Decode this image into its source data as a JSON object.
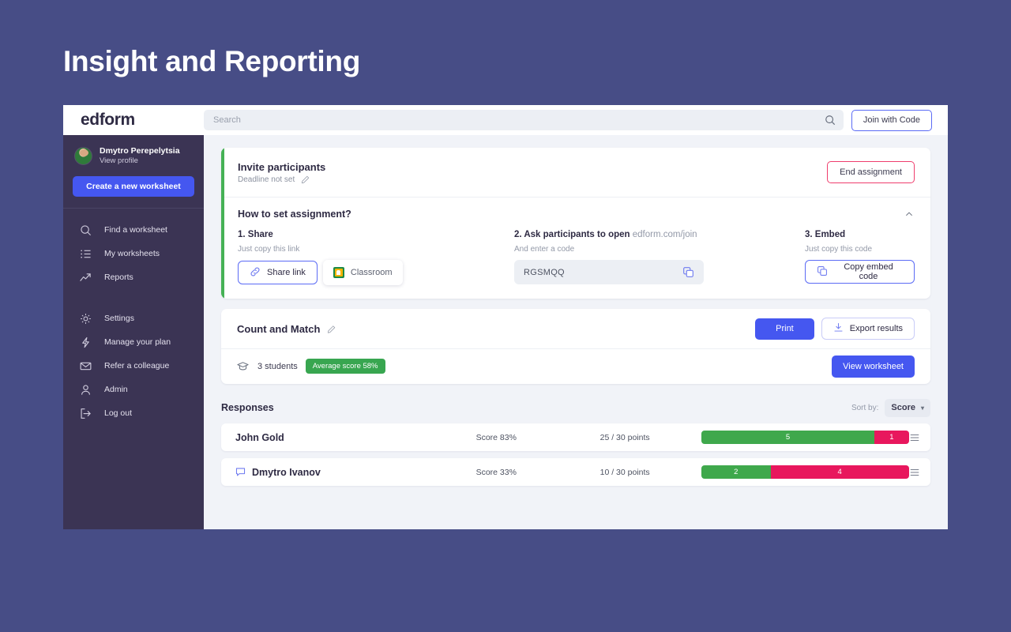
{
  "page": {
    "title": "Insight and Reporting"
  },
  "topbar": {
    "brand": "edform",
    "search_placeholder": "Search",
    "search_value": "",
    "join_label": "Join with Code"
  },
  "sidebar": {
    "profile": {
      "name": "Dmytro Perepelytsia",
      "link": "View profile"
    },
    "create_label": "Create a new worksheet",
    "items": [
      {
        "label": "Find a worksheet",
        "icon": "search-icon"
      },
      {
        "label": "My worksheets",
        "icon": "list-icon"
      },
      {
        "label": "Reports",
        "icon": "trend-up-icon"
      },
      {
        "label": "Settings",
        "icon": "gear-icon"
      },
      {
        "label": "Manage your plan",
        "icon": "bolt-icon"
      },
      {
        "label": "Refer a colleague",
        "icon": "envelope-icon"
      },
      {
        "label": "Admin",
        "icon": "user-icon"
      },
      {
        "label": "Log out",
        "icon": "logout-icon"
      }
    ]
  },
  "invite": {
    "title": "Invite participants",
    "deadline": "Deadline not set",
    "end_label": "End assignment",
    "howto_title": "How to set assignment?",
    "step1": {
      "title": "1. Share",
      "sub": "Just copy this link",
      "share_label": "Share link",
      "classroom_label": "Classroom"
    },
    "step2": {
      "title_bold": "2. Ask participants to open",
      "title_muted": "edform.com/join",
      "sub": "And enter a code",
      "code": "RGSMQQ"
    },
    "step3": {
      "title": "3. Embed",
      "sub": "Just copy this code",
      "copy_label": "Copy embed code"
    }
  },
  "worksheet": {
    "title": "Count and Match",
    "print_label": "Print",
    "export_label": "Export results",
    "students": "3 students",
    "avg_badge": "Average score 58%",
    "view_label": "View worksheet"
  },
  "responses": {
    "heading": "Responses",
    "sort_label": "Sort by:",
    "sort_value": "Score",
    "rows": [
      {
        "name": "John Gold",
        "has_comment": false,
        "score": "Score 83%",
        "points": "25 / 30 points",
        "correct": 5,
        "incorrect": 1,
        "correct_label": "5",
        "incorrect_label": "1"
      },
      {
        "name": "Dmytro Ivanov",
        "has_comment": true,
        "score": "Score 33%",
        "points": "10 / 30 points",
        "correct": 2,
        "incorrect": 4,
        "correct_label": "2",
        "incorrect_label": "4"
      }
    ]
  },
  "colors": {
    "backdrop": "#474d86",
    "sidebar": "#3b3454",
    "accent_blue": "#4557f0",
    "accent_green": "#45b155",
    "bar_green": "#3fa84c",
    "bar_red": "#e8175d",
    "badge_green": "#38a650",
    "danger_pink": "#ef3e6d"
  }
}
